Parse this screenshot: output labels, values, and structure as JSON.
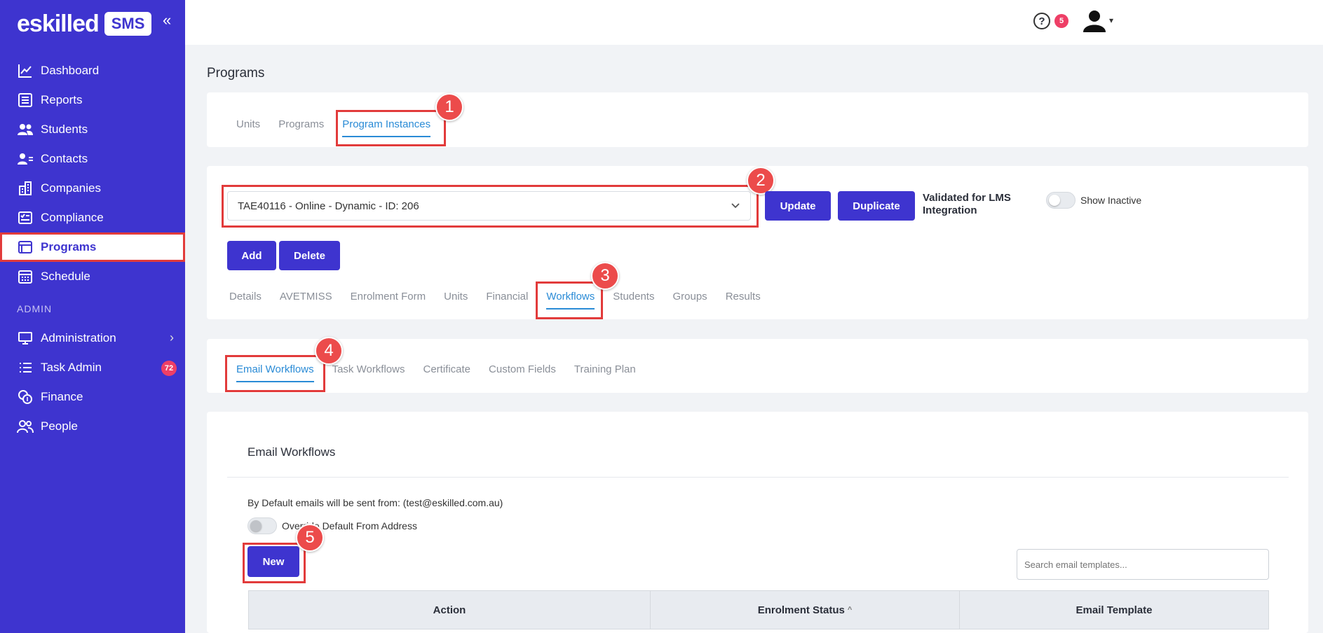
{
  "brand": {
    "name": "eskilled",
    "badge": "SMS",
    "collapse_glyph": "«"
  },
  "sidebar": {
    "items": [
      {
        "label": "Dashboard",
        "icon": "chart-line-icon"
      },
      {
        "label": "Reports",
        "icon": "document-list-icon"
      },
      {
        "label": "Students",
        "icon": "users-icon"
      },
      {
        "label": "Contacts",
        "icon": "contact-icon"
      },
      {
        "label": "Companies",
        "icon": "building-icon"
      },
      {
        "label": "Compliance",
        "icon": "checklist-icon"
      },
      {
        "label": "Programs",
        "icon": "browser-window-icon",
        "active": true
      },
      {
        "label": "Schedule",
        "icon": "calendar-icon"
      }
    ],
    "admin_heading": "ADMIN",
    "admin_items": [
      {
        "label": "Administration",
        "icon": "monitor-icon",
        "chevron": "›"
      },
      {
        "label": "Task Admin",
        "icon": "list-icon",
        "badge": "72"
      },
      {
        "label": "Finance",
        "icon": "coins-icon"
      },
      {
        "label": "People",
        "icon": "people-icon"
      }
    ]
  },
  "topbar": {
    "help_glyph": "?",
    "notification_count": "5",
    "caret": "▾"
  },
  "page": {
    "title": "Programs"
  },
  "main_tabs": {
    "items": [
      "Units",
      "Programs",
      "Program Instances"
    ],
    "active": "Program Instances"
  },
  "instance": {
    "selected": "TAE40116 - Online - Dynamic - ID: 206",
    "chevron": "⌄",
    "update_label": "Update",
    "duplicate_label": "Duplicate",
    "validated_label": "Validated for LMS Integration",
    "show_inactive_label": "Show Inactive",
    "add_label": "Add",
    "delete_label": "Delete"
  },
  "detail_tabs": {
    "items": [
      "Details",
      "AVETMISS",
      "Enrolment Form",
      "Units",
      "Financial",
      "Workflows",
      "Students",
      "Groups",
      "Results"
    ],
    "active": "Workflows"
  },
  "workflow_tabs": {
    "items": [
      "Email Workflows",
      "Task Workflows",
      "Certificate",
      "Custom Fields",
      "Training Plan"
    ],
    "active": "Email Workflows"
  },
  "email_workflows": {
    "title": "Email Workflows",
    "default_from_text": "By Default emails will be sent from: (test@eskilled.com.au)",
    "override_label": "Override Default From Address",
    "new_label": "New",
    "search_placeholder": "Search email templates...",
    "columns": [
      "Action",
      "Enrolment Status",
      "Email Template"
    ],
    "sort_glyph": "^"
  },
  "markers": [
    "1",
    "2",
    "3",
    "4",
    "5"
  ],
  "colors": {
    "sidebar": "#3e34cf",
    "accent_tab": "#2a8bd6",
    "highlight": "#e23b3b",
    "badge": "#ee3f66"
  }
}
